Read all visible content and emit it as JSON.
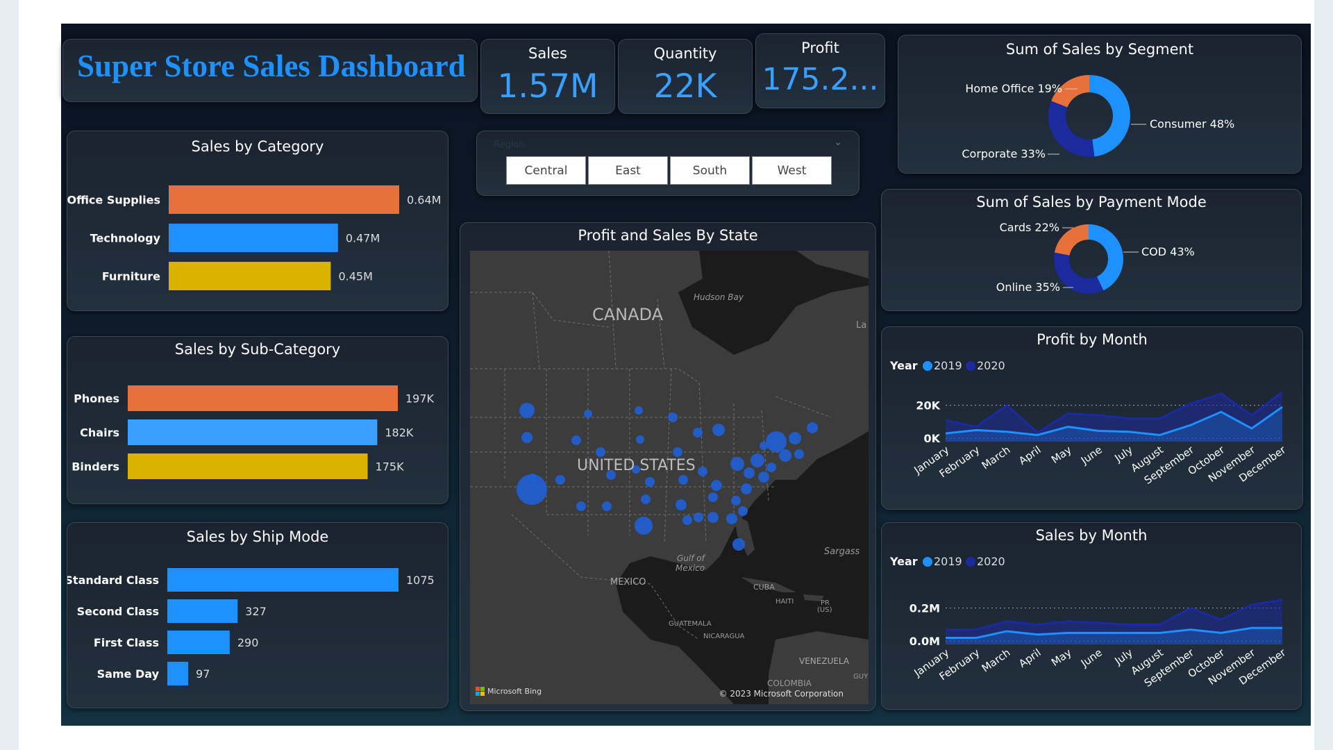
{
  "header": {
    "title": "Super Store Sales Dashboard"
  },
  "kpis": [
    {
      "label": "Sales",
      "value": "1.57M"
    },
    {
      "label": "Quantity",
      "value": "22K"
    },
    {
      "label": "Profit",
      "value": "175.2..."
    }
  ],
  "region_filter": {
    "label": "Region",
    "options": [
      "Central",
      "East",
      "South",
      "West"
    ]
  },
  "map": {
    "title": "Profit and Sales By State",
    "labels": {
      "canada": "CANADA",
      "us": "UNITED STATES",
      "hudson": "Hudson Bay",
      "la": "La",
      "gulf1": "Gulf of",
      "gulf2": "Mexico",
      "mexico": "MEXICO",
      "cuba": "CUBA",
      "haiti": "HAITI",
      "pr1": "PR",
      "pr2": "(US)",
      "guatemala": "GUATEMALA",
      "nicaragua": "NICARAGUA",
      "venezuela": "VENEZUELA",
      "colombia": "COLOMBIA",
      "sargasso": "Sargass",
      "guy": "GUY"
    },
    "attribution": "Microsoft Bing",
    "copyright": "© 2023 Microsoft Corporation",
    "bubble_color": "#1f5fd6"
  },
  "colors": {
    "orange": "#e8703a",
    "blue": "#1e90ff",
    "lightblue": "#3aa0ff",
    "yellow": "#d9b300",
    "navy": "#1b2a9c",
    "line2019": "#1e90ff",
    "line2020": "#1b2a9c"
  },
  "chart_data": [
    {
      "id": "category",
      "type": "bar",
      "orientation": "horizontal",
      "title": "Sales by Category",
      "categories": [
        "Office Supplies",
        "Technology",
        "Furniture"
      ],
      "values": [
        0.64,
        0.47,
        0.45
      ],
      "value_labels": [
        "0.64M",
        "0.47M",
        "0.45M"
      ],
      "bar_colors": [
        "#e8703a",
        "#1e90ff",
        "#d9b300"
      ]
    },
    {
      "id": "subcategory",
      "type": "bar",
      "orientation": "horizontal",
      "title": "Sales by Sub-Category",
      "categories": [
        "Phones",
        "Chairs",
        "Binders"
      ],
      "values": [
        197,
        182,
        175
      ],
      "value_labels": [
        "197K",
        "182K",
        "175K"
      ],
      "bar_colors": [
        "#e8703a",
        "#3aa0ff",
        "#d9b300"
      ]
    },
    {
      "id": "shipmode",
      "type": "bar",
      "orientation": "horizontal",
      "title": "Sales by Ship Mode",
      "categories": [
        "Standard Class",
        "Second Class",
        "First Class",
        "Same Day"
      ],
      "values": [
        1075,
        327,
        290,
        97
      ],
      "value_labels": [
        "1075",
        "327",
        "290",
        "97"
      ],
      "bar_colors": [
        "#1e90ff",
        "#1e90ff",
        "#1e90ff",
        "#1e90ff"
      ]
    },
    {
      "id": "segment",
      "type": "pie",
      "donut": true,
      "title": "Sum of Sales by Segment",
      "slices": [
        {
          "label": "Consumer 48%",
          "value": 48,
          "color": "#1e90ff"
        },
        {
          "label": "Corporate 33%",
          "value": 33,
          "color": "#1b2a9c"
        },
        {
          "label": "Home Office 19%",
          "value": 19,
          "color": "#e8703a"
        }
      ]
    },
    {
      "id": "payment",
      "type": "pie",
      "donut": true,
      "title": "Sum of Sales by Payment Mode",
      "slices": [
        {
          "label": "COD 43%",
          "value": 43,
          "color": "#1e90ff"
        },
        {
          "label": "Online 35%",
          "value": 35,
          "color": "#1b2a9c"
        },
        {
          "label": "Cards 22%",
          "value": 22,
          "color": "#e8703a"
        }
      ]
    },
    {
      "id": "profit_month",
      "type": "area",
      "title": "Profit by Month",
      "legend_title": "Year",
      "legend_position": "top-left",
      "categories": [
        "January",
        "February",
        "March",
        "April",
        "May",
        "June",
        "July",
        "August",
        "September",
        "October",
        "November",
        "December"
      ],
      "yticks": [
        "0K",
        "20K"
      ],
      "ytick_values": [
        0,
        20000
      ],
      "ylim": [
        -2000,
        27000
      ],
      "series": [
        {
          "name": "2019",
          "values": [
            3000,
            5000,
            4000,
            2000,
            7000,
            4500,
            4000,
            2000,
            8000,
            16000,
            6000,
            19000
          ]
        },
        {
          "name": "2020",
          "values": [
            11000,
            7000,
            20000,
            3500,
            15000,
            14000,
            12000,
            12000,
            21000,
            27000,
            14000,
            28000
          ]
        }
      ]
    },
    {
      "id": "sales_month",
      "type": "area",
      "title": "Sales by Month",
      "legend_title": "Year",
      "legend_position": "top-left",
      "categories": [
        "January",
        "February",
        "March",
        "April",
        "May",
        "June",
        "July",
        "August",
        "September",
        "October",
        "November",
        "December"
      ],
      "yticks": [
        "0.0M",
        "0.2M"
      ],
      "ytick_values": [
        0,
        0.2
      ],
      "ylim": [
        -0.02,
        0.27
      ],
      "series": [
        {
          "name": "2019",
          "values": [
            0.02,
            0.02,
            0.06,
            0.04,
            0.05,
            0.05,
            0.05,
            0.05,
            0.07,
            0.05,
            0.08,
            0.08
          ]
        },
        {
          "name": "2020",
          "values": [
            0.07,
            0.07,
            0.12,
            0.1,
            0.12,
            0.11,
            0.1,
            0.1,
            0.2,
            0.13,
            0.22,
            0.25
          ]
        }
      ]
    }
  ]
}
